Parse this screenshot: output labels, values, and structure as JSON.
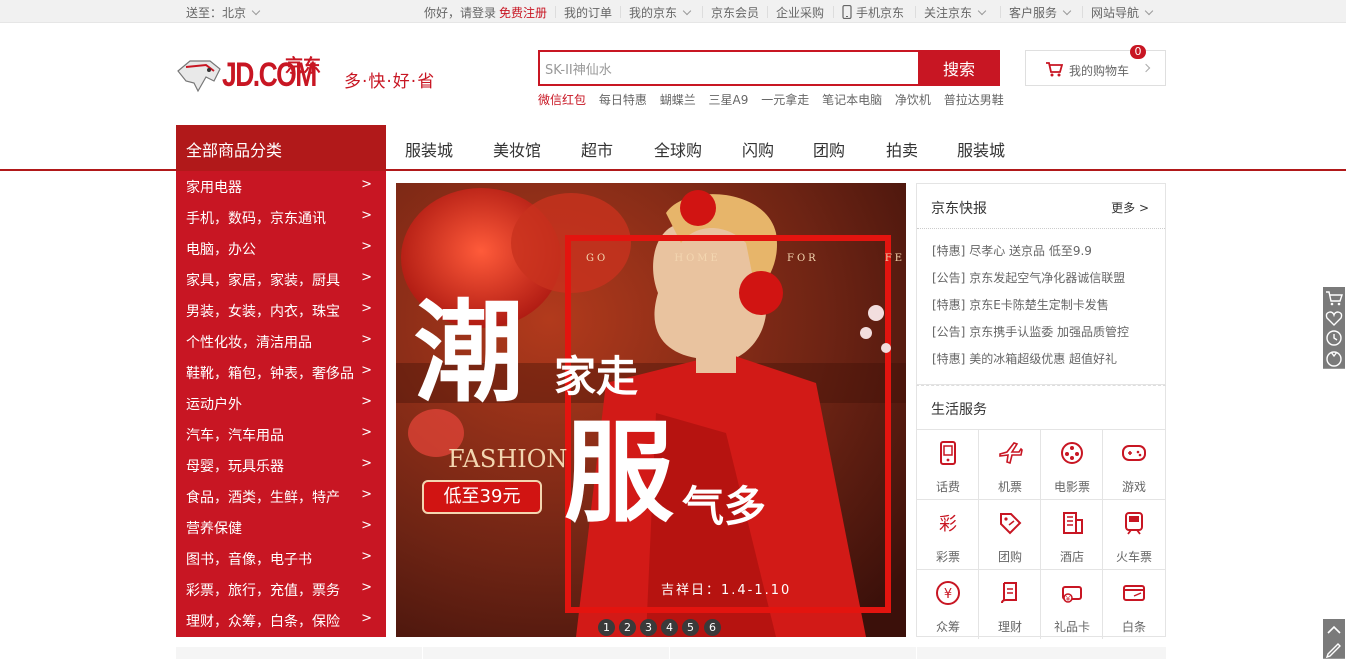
{
  "topbar": {
    "location_label": "送至：北京",
    "greeting": "你好，请登录",
    "register": "免费注册",
    "my_orders": "我的订单",
    "my_jd": "我的京东",
    "jd_member": "京东会员",
    "enterprise": "企业采购",
    "mobile": "手机京东",
    "follow": "关注京东",
    "service": "客户服务",
    "sitenav": "网站导航"
  },
  "header": {
    "logo_text": "JD.COM",
    "logo_cn": "京东",
    "slogan": "多·快·好·省",
    "search_value": "SK-II神仙水",
    "search_button": "搜索",
    "hotwords": [
      "微信红包",
      "每日特惠",
      "蝴蝶兰",
      "三星A9",
      "一元拿走",
      "笔记本电脑",
      "净饮机",
      "普拉达男鞋"
    ],
    "cart_label": "我的购物车",
    "cart_count": "0"
  },
  "nav": {
    "all_categories": "全部商品分类",
    "items": [
      "服装城",
      "美妆馆",
      "超市",
      "全球购",
      "闪购",
      "团购",
      "拍卖",
      "服装城"
    ]
  },
  "categories": [
    "家用电器",
    "手机，数码，京东通讯",
    "电脑，办公",
    "家具，家居，家装，厨具",
    "男装，女装，内衣，珠宝",
    "个性化妆，清洁用品",
    "鞋靴，箱包，钟表，奢侈品",
    "运动户外",
    "汽车，汽车用品",
    "母婴，玩具乐器",
    "食品，酒类，生鲜，特产",
    "营养保健",
    "图书，音像，电子书",
    "彩票，旅行，充值，票务",
    "理财，众筹，白条，保险"
  ],
  "category_arrow": ">",
  "banner": {
    "big_char1": "潮",
    "line1": "家走",
    "big_char2": "服",
    "line2": "气多",
    "fashion": "FASHION",
    "price": "低至39元",
    "top_text": "GO HOME FOR FESTIVAL",
    "date": "吉祥日：1.4-1.10",
    "dots": [
      "1",
      "2",
      "3",
      "4",
      "5",
      "6"
    ]
  },
  "news": {
    "title": "京东快报",
    "more": "更多 >",
    "items": [
      {
        "tag": "[特惠]",
        "text": "尽孝心 送京品 低至9.9"
      },
      {
        "tag": "[公告]",
        "text": "京东发起空气净化器诚信联盟"
      },
      {
        "tag": "[特惠]",
        "text": "京东E卡陈楚生定制卡发售"
      },
      {
        "tag": "[公告]",
        "text": "京东携手认监委 加强品质管控"
      },
      {
        "tag": "[特惠]",
        "text": "美的冰箱超级优惠 超值好礼"
      }
    ]
  },
  "services": {
    "title": "生活服务",
    "items": [
      {
        "label": "话费",
        "icon": "phone-icon"
      },
      {
        "label": "机票",
        "icon": "plane-icon"
      },
      {
        "label": "电影票",
        "icon": "film-icon"
      },
      {
        "label": "游戏",
        "icon": "gamepad-icon"
      },
      {
        "label": "彩票",
        "icon": "lottery-icon"
      },
      {
        "label": "团购",
        "icon": "tag-icon"
      },
      {
        "label": "酒店",
        "icon": "hotel-icon"
      },
      {
        "label": "火车票",
        "icon": "train-icon"
      },
      {
        "label": "众筹",
        "icon": "yuan-icon"
      },
      {
        "label": "理财",
        "icon": "scroll-icon"
      },
      {
        "label": "礼品卡",
        "icon": "gift-card-icon"
      },
      {
        "label": "白条",
        "icon": "card-icon"
      }
    ]
  },
  "colors": {
    "brand_red": "#c81623",
    "nav_red": "#b1191a"
  }
}
